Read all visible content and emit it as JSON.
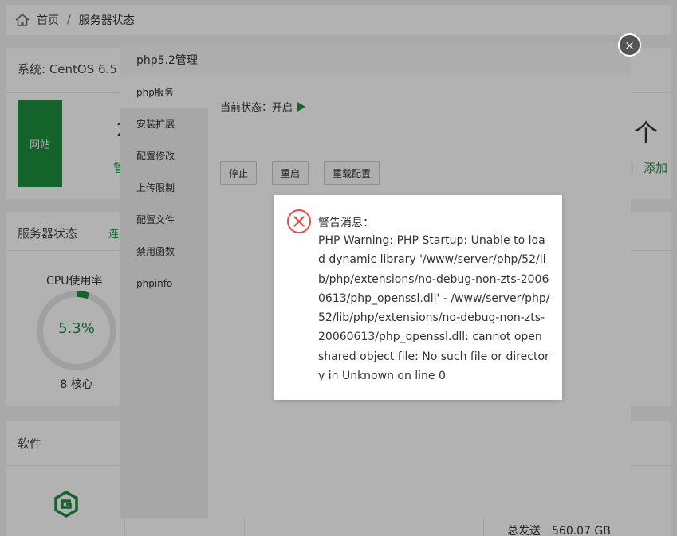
{
  "breadcrumb": {
    "home": "首页",
    "separator": "/",
    "current": "服务器状态"
  },
  "system": {
    "title": "系统: CentOS 6.5",
    "site_tile": "网站",
    "count_unit": "个",
    "partial_green": "管",
    "partial_number": "2",
    "pipe": "|",
    "add_link": "添加"
  },
  "server_status": {
    "title": "服务器状态",
    "partial_link": "连",
    "cpu_label": "CPU使用率",
    "cpu_value": "5.3%",
    "cpu_fraction": 0.053,
    "cores": "8 核心"
  },
  "software": {
    "title": "软件",
    "total_send_label": "总发送",
    "total_send_value": "560.07 GB"
  },
  "modal": {
    "title": "php5.2管理",
    "close": "×",
    "menu": [
      "php服务",
      "安装扩展",
      "配置修改",
      "上传限制",
      "配置文件",
      "禁用函数",
      "phpinfo"
    ],
    "status_label": "当前状态：开启",
    "buttons": {
      "stop": "停止",
      "restart": "重启",
      "reload": "重载配置"
    }
  },
  "alert": {
    "title": "警告消息：",
    "message": "PHP Warning: PHP Startup: Unable to load dynamic library '/www/server/php/52/lib/php/extensions/no-debug-non-zts-20060613/php_openssl.dll' - /www/server/php/52/lib/php/extensions/no-debug-non-zts-20060613/php_openssl.dll: cannot open shared object file: No such file or directory in Unknown on line 0"
  },
  "colors": {
    "accent": "#1e8e3e",
    "error": "#e04b4b",
    "overlay": "rgba(0,0,0,0.3)"
  },
  "icons": {
    "home": "home-icon",
    "close": "close-icon",
    "error": "error-circle-icon",
    "play": "play-icon",
    "software": "software-logo-icon"
  }
}
